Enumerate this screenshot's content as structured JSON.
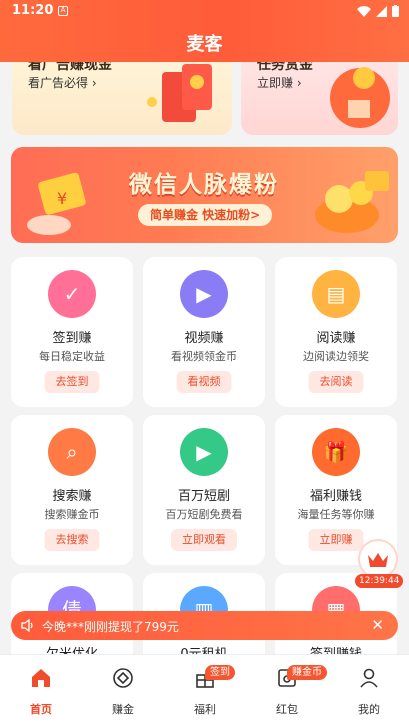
{
  "status": {
    "time": "11:20"
  },
  "header": {
    "title": "麦客"
  },
  "promo_top": [
    {
      "head": "看广告赚现金",
      "sub": "看广告必得 ›"
    },
    {
      "head": "任务赏金",
      "sub": "立即赚 ›"
    }
  ],
  "banner": {
    "title": "微信人脉爆粉",
    "pill": "简单赚金 快速加粉>"
  },
  "tasks": [
    {
      "name": "签到赚",
      "desc": "每日稳定收益",
      "btn": "去签到",
      "color": "#ff6f96"
    },
    {
      "name": "视频赚",
      "desc": "看视频领金币",
      "btn": "看视频",
      "color": "#8a7cf5"
    },
    {
      "name": "阅读赚",
      "desc": "边阅读边领奖",
      "btn": "去阅读",
      "color": "#ffb340"
    },
    {
      "name": "搜索赚",
      "desc": "搜索赚金币",
      "btn": "去搜索",
      "color": "#ff7a45"
    },
    {
      "name": "百万短剧",
      "desc": "百万短剧免费看",
      "btn": "立即观看",
      "color": "#35c987"
    },
    {
      "name": "福利赚钱",
      "desc": "海量任务等你赚",
      "btn": "立即赚",
      "color": "#ff6a2e"
    },
    {
      "name": "欠米优化",
      "desc": "",
      "btn": "",
      "color": "#9a84ff"
    },
    {
      "name": "0元租机",
      "desc": "",
      "btn": "",
      "color": "#5aa8ff"
    },
    {
      "name": "签到赚钱",
      "desc": "",
      "btn": "",
      "color": "#ff6d6d"
    }
  ],
  "float_timer": "12:39:44",
  "notice": {
    "text": "今晚***刚刚提现了799元"
  },
  "tabbar": [
    {
      "label": "首页",
      "badge": ""
    },
    {
      "label": "赚金",
      "badge": ""
    },
    {
      "label": "福利",
      "badge": "签到"
    },
    {
      "label": "红包",
      "badge": "赚金币"
    },
    {
      "label": "我的",
      "badge": ""
    }
  ]
}
